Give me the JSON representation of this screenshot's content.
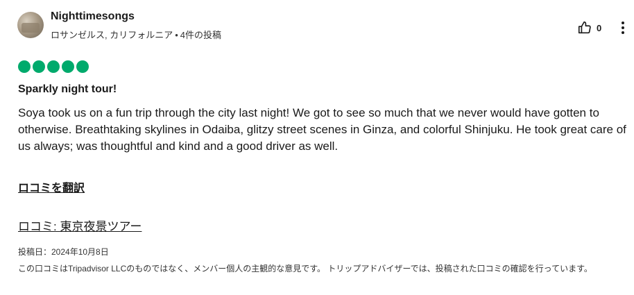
{
  "reviewer": {
    "name": "Nighttimesongs",
    "location": "ロサンゼルス, カリフォルニア",
    "separator": "•",
    "contributions": "4件の投稿"
  },
  "actions": {
    "helpful_count": "0",
    "helpful_icon": "thumbs-up-icon",
    "more_icon": "more-vertical-icon"
  },
  "rating": {
    "value": 5,
    "max": 5,
    "color": "#00aa6c"
  },
  "review": {
    "title": "Sparkly night tour!",
    "body": "Soya took us on a fun trip through the city last night! We got to see so much that we never would have gotten to otherwise. Breathtaking skylines in Odaiba, glitzy street scenes in Ginza, and colorful Shinjuku. He took great care of us always; was thoughtful and kind and a good driver as well.",
    "translate_label": "ロコミを翻訳",
    "subject_link": "ロコミ: 東京夜景ツアー",
    "posted_date": "投稿日：2024年10月8日",
    "disclaimer": "この口コミはTripadvisor LLCのものではなく、メンバー個人の主観的な意見です。 トリップアドバイザーでは、投稿された口コミの確認を行っています。"
  }
}
